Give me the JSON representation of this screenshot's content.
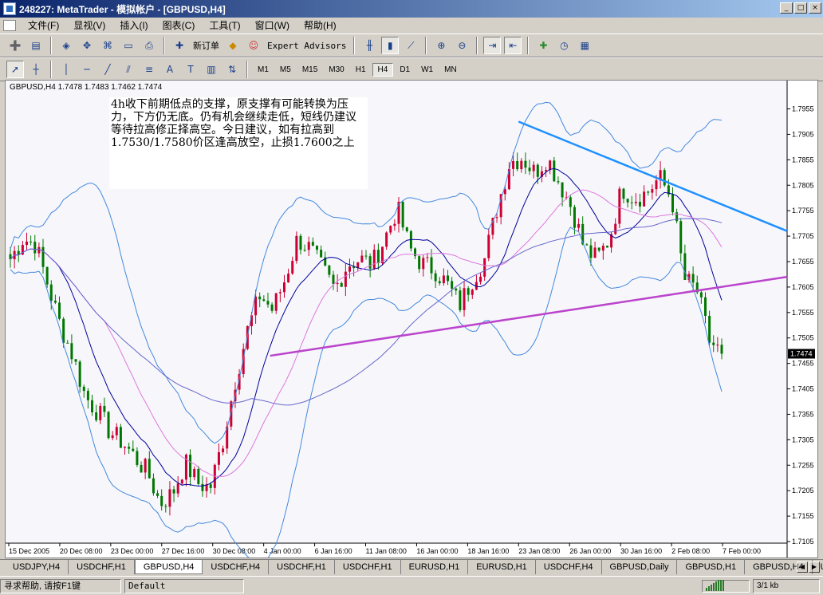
{
  "window": {
    "title": "248227: MetaTrader - 模拟帐户 - [GBPUSD,H4]",
    "buttons": [
      "_",
      "□",
      "×"
    ]
  },
  "menu": {
    "items": [
      "文件(F)",
      "显视(V)",
      "插入(I)",
      "图表(C)",
      "工具(T)",
      "窗口(W)",
      "帮助(H)"
    ]
  },
  "toolbar": {
    "new_order": "新订单",
    "expert_advisors": "Expert Advisors",
    "timeframes": [
      "M1",
      "M5",
      "M15",
      "M30",
      "H1",
      "H4",
      "D1",
      "W1",
      "MN"
    ],
    "active_timeframe": "H4"
  },
  "chart": {
    "header": "GBPUSD,H4  1.7478 1.7483 1.7462 1.7474",
    "current_price": "1.7474",
    "annotation": "4h收下前期低点的支撑，原支撑有可能转换为压力，下方仍无底。仍有机会继续走低，短线仍建议等待拉高修正择高空。今日建议，如有拉高到1.7530/1.7580价区逢高放空，止损1.7600之上",
    "colors": {
      "bull_candle": "#cc0033",
      "bear_candle": "#007700",
      "bollinger": "#4488dd",
      "ma_fast": "#000099",
      "ma_slow": "#dd77dd",
      "ma_long": "#6666cc",
      "resistance_line": "#1e90ff",
      "support_line": "#bb44cc"
    }
  },
  "chart_data": {
    "type": "candlestick",
    "symbol": "GBPUSD",
    "timeframe": "H4",
    "ylim": [
      1.7105,
      1.7995
    ],
    "yticks": [
      "1.7955",
      "1.7905",
      "1.7855",
      "1.7805",
      "1.7755",
      "1.7705",
      "1.7655",
      "1.7605",
      "1.7555",
      "1.7505",
      "1.7455",
      "1.7405",
      "1.7355",
      "1.7305",
      "1.7255",
      "1.7205",
      "1.7155",
      "1.7105"
    ],
    "xticks": [
      "15 Dec 2005",
      "20 Dec 08:00",
      "23 Dec 00:00",
      "27 Dec 16:00",
      "30 Dec 08:00",
      "4 Jan 00:00",
      "6 Jan 16:00",
      "11 Jan 08:00",
      "16 Jan 00:00",
      "18 Jan 16:00",
      "23 Jan 08:00",
      "26 Jan 00:00",
      "30 Jan 16:00",
      "2 Feb 08:00",
      "7 Feb 00:00"
    ],
    "close_path": [
      1.766,
      1.77,
      1.769,
      1.761,
      1.753,
      1.747,
      1.739,
      1.736,
      1.732,
      1.73,
      1.727,
      1.724,
      1.718,
      1.72,
      1.726,
      1.722,
      1.721,
      1.73,
      1.742,
      1.752,
      1.759,
      1.756,
      1.762,
      1.77,
      1.768,
      1.764,
      1.76,
      1.765,
      1.766,
      1.765,
      1.77,
      1.776,
      1.768,
      1.765,
      1.764,
      1.761,
      1.757,
      1.762,
      1.766,
      1.776,
      1.785,
      1.786,
      1.783,
      1.786,
      1.781,
      1.776,
      1.768,
      1.766,
      1.77,
      1.78,
      1.778,
      1.779,
      1.782,
      1.778,
      1.762,
      1.76,
      1.75,
      1.7474
    ],
    "resistance_line": {
      "from": [
        "23 Jan 08:00",
        1.793
      ],
      "to": [
        "7 Feb 00:00+",
        1.7715
      ]
    },
    "support_line": {
      "from": [
        "4 Jan 00:00",
        1.747
      ],
      "to": [
        "7 Feb 00:00+",
        1.7625
      ]
    }
  },
  "tabs": {
    "items": [
      "USDJPY,H4",
      "USDCHF,H1",
      "GBPUSD,H4",
      "USDCHF,H4",
      "USDCHF,H1",
      "USDCHF,H1",
      "EURUSD,H1",
      "EURUSD,H1",
      "USDCHF,H4",
      "GBPUSD,Daily",
      "GBPUSD,H1",
      "GBPUSD,H4",
      "US"
    ],
    "active_index": 2
  },
  "status": {
    "help": "寻求帮助, 请按F1键",
    "profile": "Default",
    "connection": "3/1 kb"
  }
}
